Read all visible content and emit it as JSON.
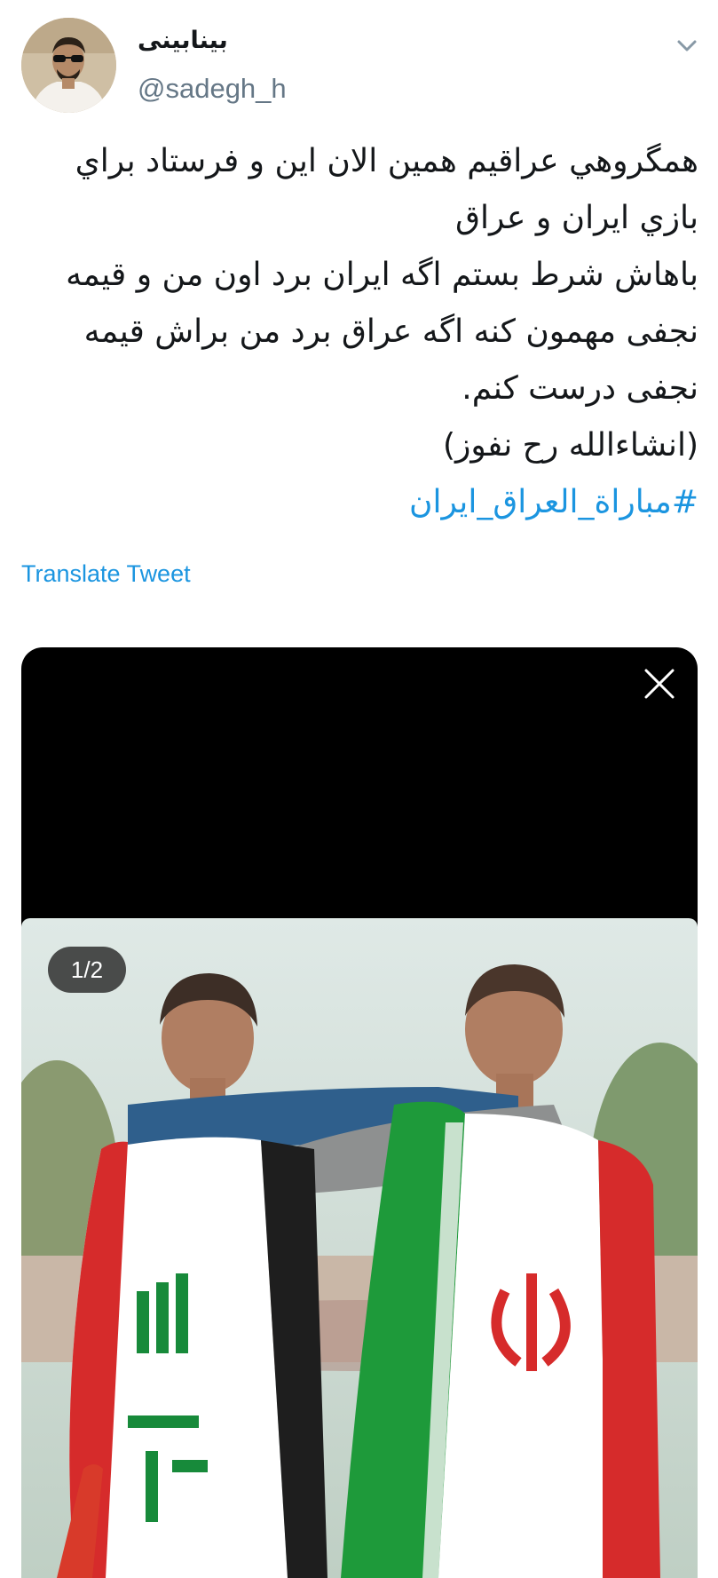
{
  "author": {
    "display_name": "بینابینی",
    "handle": "@sadegh_h",
    "avatar_icon": "user-avatar"
  },
  "menu_icon": "chevron-down-icon",
  "tweet": {
    "lines": [
      "همگروهي عراقيم همين الان اين و فرستاد براي",
      "بازي ايران و عراق",
      "باهاش شرط بستم اگه ایران برد اون من و قیمه",
      "نجفی مهمون کنه اگه عراق برد من براش قیمه",
      "نجفی درست کنم.",
      "(انشاءالله رح نفوز)"
    ],
    "hashtag": "#مباراة_العراق_ايران"
  },
  "translate_label": "Translate Tweet",
  "media": {
    "counter": "1/2",
    "close_icon": "close-icon"
  },
  "colors": {
    "link": "#1b95e0",
    "secondary_text": "#657786",
    "primary_text": "#14171a",
    "media_background": "#000000"
  }
}
